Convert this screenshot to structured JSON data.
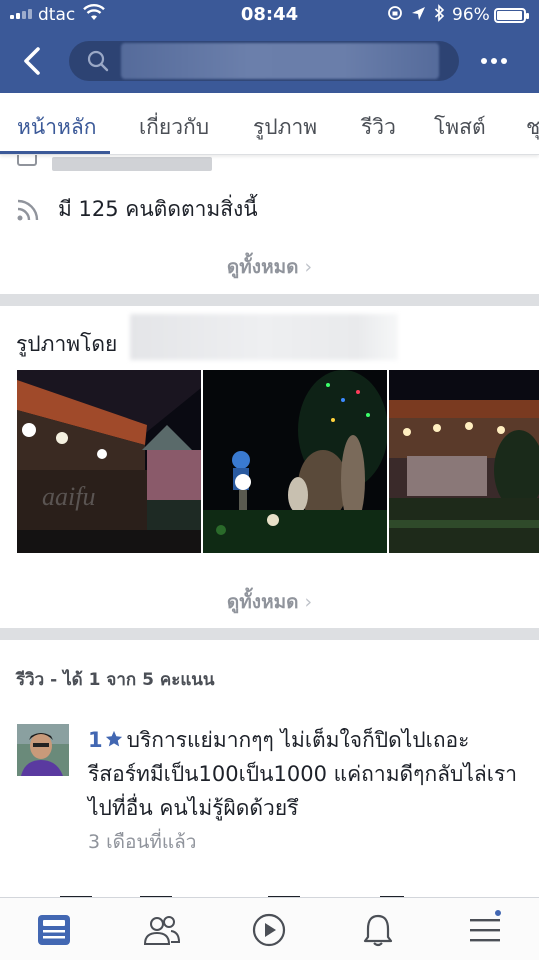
{
  "status_bar": {
    "carrier": "dtac",
    "time": "08:44",
    "battery_percent": "96%",
    "battery_level": 0.96
  },
  "header": {
    "back_icon": "chevron-left-icon",
    "search_icon": "search-icon",
    "more_icon": "more-dots-icon",
    "colors": {
      "nav_bg": "#3b5998",
      "search_bg": "#2d4373"
    }
  },
  "tabs": [
    {
      "label": "หน้าหลัก",
      "active": true
    },
    {
      "label": "เกี่ยวกับ",
      "active": false
    },
    {
      "label": "รูปภาพ",
      "active": false
    },
    {
      "label": "รีวิว",
      "active": false
    },
    {
      "label": "โพสต์",
      "active": false
    },
    {
      "label": "ชุ",
      "active": false
    }
  ],
  "about": {
    "followers_text": "มี 125 คนติดตามสิ่งนี้",
    "followers_icon": "rss-icon",
    "see_all": "ดูทั้งหมด"
  },
  "photos": {
    "title": "รูปภาพโดย",
    "see_all": "ดูทั้งหมด"
  },
  "reviews": {
    "heading": "รีวิว - ได้ 1 จาก 5 คะแนน",
    "items": [
      {
        "rating": "1",
        "text": "บริการแย่มากๆๆ ไม่เต็มใจก็ปิดไปเถอะรีสอร์ทมีเป็น100เป็น1000 แค่ถามดีๆกลับไล่เราไปที่อื่น คนไม่รู้ผิดด้วยรึ",
        "time": "3 เดือนที่แล้ว"
      }
    ]
  },
  "bottom_nav": [
    {
      "icon": "news-feed-icon",
      "active": true
    },
    {
      "icon": "friends-icon",
      "active": false
    },
    {
      "icon": "video-play-icon",
      "active": false
    },
    {
      "icon": "bell-icon",
      "active": false
    },
    {
      "icon": "menu-icon",
      "active": false,
      "badge": true
    }
  ]
}
